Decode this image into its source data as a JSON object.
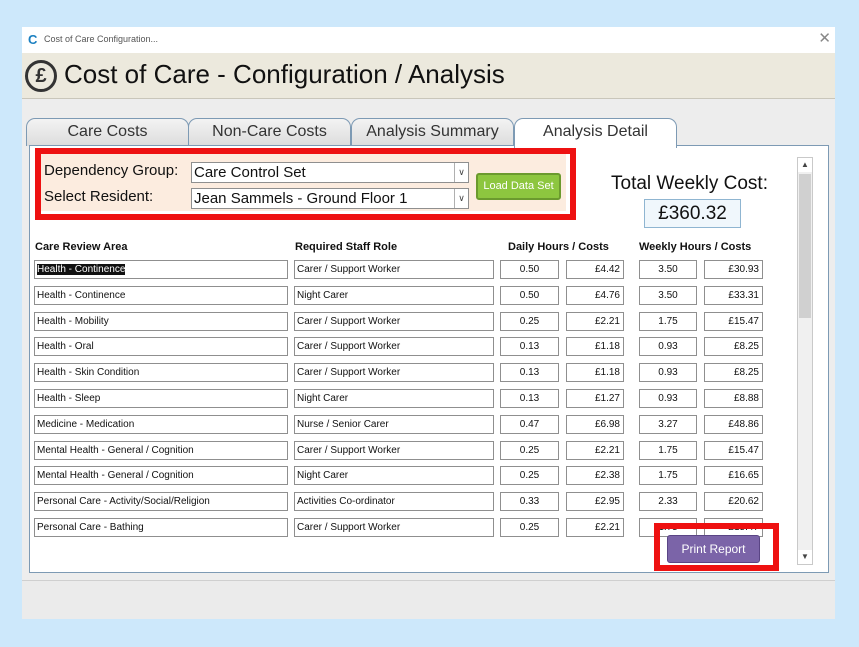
{
  "window": {
    "title": "Cost of Care Configuration...",
    "close_glyph": "✕",
    "app_icon_glyph": "C"
  },
  "header": {
    "icon_glyph": "£",
    "title": "Cost of Care - Configuration / Analysis"
  },
  "tabs": [
    {
      "label": "Care Costs",
      "active": false
    },
    {
      "label": "Non-Care Costs",
      "active": false
    },
    {
      "label": "Analysis Summary",
      "active": false
    },
    {
      "label": "Analysis Detail",
      "active": true
    }
  ],
  "filters": {
    "dependency_label": "Dependency Group:",
    "dependency_value": "Care Control Set",
    "resident_label": "Select Resident:",
    "resident_value": "Jean Sammels - Ground Floor 1",
    "load_button": "Load Data Set"
  },
  "total": {
    "label": "Total Weekly Cost:",
    "value": "£360.32"
  },
  "columns": {
    "area": "Care Review Area",
    "role": "Required Staff Role",
    "daily": "Daily Hours / Costs",
    "weekly": "Weekly Hours / Costs"
  },
  "rows": [
    {
      "area": "Health - Continence",
      "role": "Carer / Support Worker",
      "dh": "0.50",
      "dc": "£4.42",
      "wh": "3.50",
      "wc": "£30.93",
      "selected": true
    },
    {
      "area": "Health - Continence",
      "role": "Night Carer",
      "dh": "0.50",
      "dc": "£4.76",
      "wh": "3.50",
      "wc": "£33.31"
    },
    {
      "area": "Health - Mobility",
      "role": "Carer / Support Worker",
      "dh": "0.25",
      "dc": "£2.21",
      "wh": "1.75",
      "wc": "£15.47"
    },
    {
      "area": "Health - Oral",
      "role": "Carer / Support Worker",
      "dh": "0.13",
      "dc": "£1.18",
      "wh": "0.93",
      "wc": "£8.25"
    },
    {
      "area": "Health - Skin Condition",
      "role": "Carer / Support Worker",
      "dh": "0.13",
      "dc": "£1.18",
      "wh": "0.93",
      "wc": "£8.25"
    },
    {
      "area": "Health - Sleep",
      "role": "Night Carer",
      "dh": "0.13",
      "dc": "£1.27",
      "wh": "0.93",
      "wc": "£8.88"
    },
    {
      "area": "Medicine - Medication",
      "role": "Nurse / Senior Carer",
      "dh": "0.47",
      "dc": "£6.98",
      "wh": "3.27",
      "wc": "£48.86"
    },
    {
      "area": "Mental Health - General / Cognition",
      "role": "Carer / Support Worker",
      "dh": "0.25",
      "dc": "£2.21",
      "wh": "1.75",
      "wc": "£15.47"
    },
    {
      "area": "Mental Health - General / Cognition",
      "role": "Night Carer",
      "dh": "0.25",
      "dc": "£2.38",
      "wh": "1.75",
      "wc": "£16.65"
    },
    {
      "area": "Personal Care - Activity/Social/Religion",
      "role": "Activities Co-ordinator",
      "dh": "0.33",
      "dc": "£2.95",
      "wh": "2.33",
      "wc": "£20.62"
    },
    {
      "area": "Personal Care - Bathing",
      "role": "Carer / Support Worker",
      "dh": "0.25",
      "dc": "£2.21",
      "wh": "1.75",
      "wc": "£15.47"
    }
  ],
  "actions": {
    "print_button": "Print Report"
  },
  "scrollbar": {
    "up_glyph": "▲",
    "down_glyph": "▼"
  },
  "colors": {
    "highlight_frame": "#ee1111",
    "load_button": "#8dc63f",
    "print_button": "#7b64a8",
    "filter_background": "#fcecdf"
  }
}
